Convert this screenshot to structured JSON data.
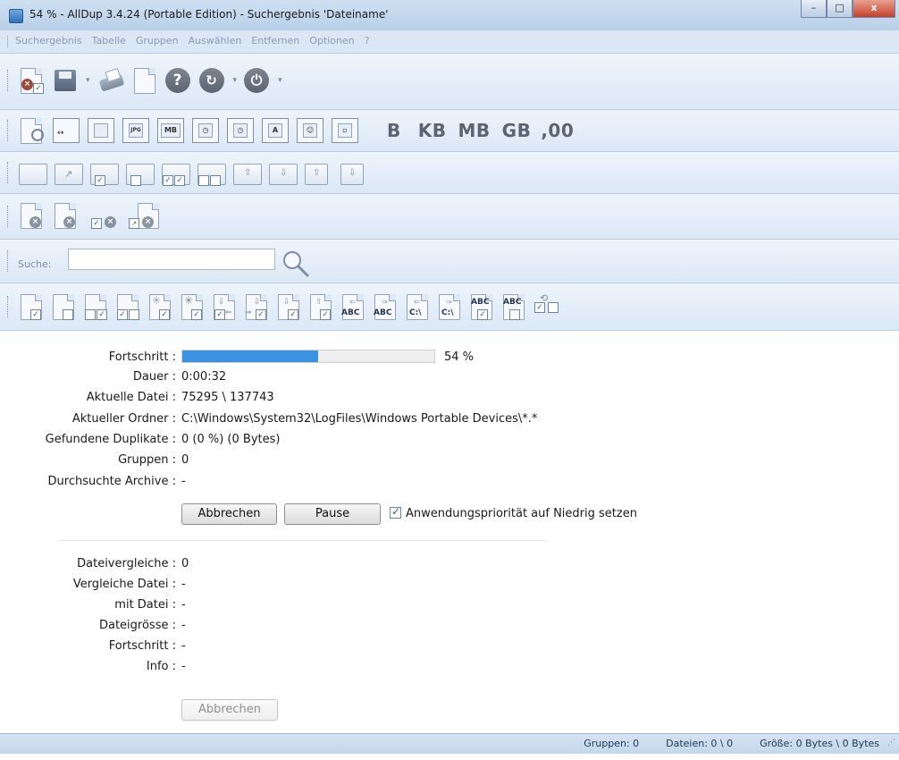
{
  "window": {
    "title": "54 % - AllDup 3.4.24 (Portable Edition) - Suchergebnis 'Dateiname'",
    "minimize_glyph": "–",
    "maximize_glyph": "□",
    "close_glyph": "x"
  },
  "menu": {
    "items": [
      "Suchergebnis",
      "Tabelle",
      "Gruppen",
      "Auswählen",
      "Entfernen",
      "Optionen",
      "?"
    ]
  },
  "toolbar2": {
    "icon_labels": [
      "MB",
      "A"
    ],
    "units": [
      "B",
      "KB",
      "MB",
      "GB",
      ",00"
    ]
  },
  "toolbar6": {
    "small_labels": [
      "ABC",
      "ABC",
      "C:\\",
      "C:\\",
      "ABC",
      "ABC"
    ]
  },
  "search": {
    "label": "Suche:",
    "value": "",
    "placeholder": ""
  },
  "progress": {
    "label": "Fortschritt :",
    "percent_text": "54 %",
    "fraction": 0.54
  },
  "info_rows": [
    {
      "label": "Dauer :",
      "value": "0:00:32"
    },
    {
      "label": "Aktuelle Datei :",
      "value": "75295 \\ 137743"
    },
    {
      "label": "Aktueller Ordner :",
      "value": "C:\\Windows\\System32\\LogFiles\\Windows Portable Devices\\*.*"
    },
    {
      "label": "Gefundene Duplikate :",
      "value": "0 (0 %) (0 Bytes)"
    },
    {
      "label": "Gruppen :",
      "value": "0"
    },
    {
      "label": "Durchsuchte Archive :",
      "value": "-"
    }
  ],
  "buttons": {
    "cancel": "Abbrechen",
    "pause": "Pause",
    "priority_checkbox": "Anwendungspriorität auf Niedrig setzen",
    "priority_checked": true,
    "cancel2": "Abbrechen"
  },
  "compare_rows": [
    {
      "label": "Dateivergleiche :",
      "value": "0"
    },
    {
      "label": "Vergleiche Datei :",
      "value": "-"
    },
    {
      "label": "mit Datei :",
      "value": "-"
    },
    {
      "label": "Dateigrösse :",
      "value": "-"
    },
    {
      "label": "Fortschritt :",
      "value": "-"
    },
    {
      "label": "Info :",
      "value": "-"
    }
  ],
  "status": {
    "groups": "Gruppen: 0",
    "files": "Dateien: 0 \\ 0",
    "size": "Größe: 0 Bytes \\ 0 Bytes"
  },
  "colors": {
    "progress_fill": "#3a93e0",
    "title_bar": "#c4d7ee",
    "close_button": "#c4422c"
  }
}
